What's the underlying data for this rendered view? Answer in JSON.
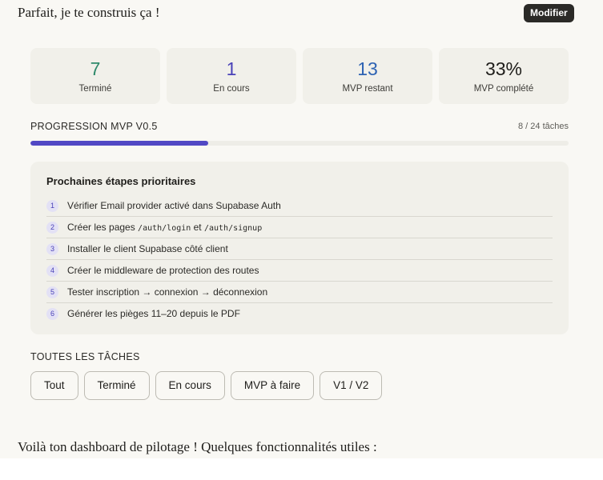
{
  "message": {
    "intro": "Parfait, je te construis ça !",
    "edit_label": "Modifier",
    "outro": "Voilà ton dashboard de pilotage ! Quelques fonctionnalités utiles :"
  },
  "stats": [
    {
      "value": "7",
      "label": "Terminé",
      "color": "#2f8a6b"
    },
    {
      "value": "1",
      "label": "En cours",
      "color": "#4a42b8"
    },
    {
      "value": "13",
      "label": "MVP restant",
      "color": "#2e63b3"
    },
    {
      "value": "33%",
      "label": "MVP complété",
      "color": "#1f1e1b"
    }
  ],
  "progress": {
    "title": "PROGRESSION MVP V0.5",
    "count": "8 / 24 tâches",
    "fraction": 0.33,
    "color": "#5148c4"
  },
  "next_steps": {
    "title": "Prochaines étapes prioritaires",
    "items": [
      {
        "num": "1",
        "text": "Vérifier Email provider activé dans Supabase Auth"
      },
      {
        "num": "2",
        "text_before": "Créer les pages ",
        "code1": "/auth/login",
        "text_mid": " et ",
        "code2": "/auth/signup"
      },
      {
        "num": "3",
        "text": "Installer le client Supabase côté client"
      },
      {
        "num": "4",
        "text": "Créer le middleware de protection des routes"
      },
      {
        "num": "5",
        "text": "Tester inscription → connexion → déconnexion"
      },
      {
        "num": "6",
        "text": "Générer les pièges 11–20 depuis le PDF"
      }
    ]
  },
  "all_tasks": {
    "title": "TOUTES LES TÂCHES",
    "filters": [
      "Tout",
      "Terminé",
      "En cours",
      "MVP à faire",
      "V1 / V2"
    ]
  }
}
